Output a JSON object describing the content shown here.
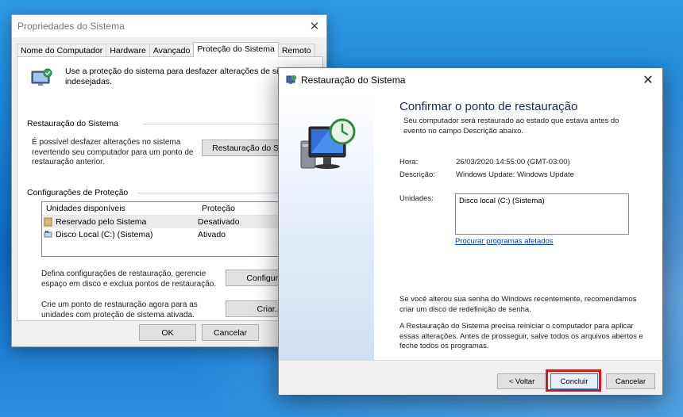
{
  "back_window": {
    "title": "Propriedades do Sistema",
    "tabs": [
      "Nome do Computador",
      "Hardware",
      "Avançado",
      "Proteção do Sistema",
      "Remoto"
    ],
    "active_tab": "Proteção do Sistema",
    "intro_text": "Use a proteção do sistema para desfazer alterações de sistema indesejadas.",
    "restore_section": {
      "title": "Restauração do Sistema",
      "description": "É possível desfazer alterações no sistema revertendo seu computador para um ponto de restauração anterior.",
      "button": "Restauração do Sistema..."
    },
    "protection_section": {
      "title": "Configurações de Proteção",
      "columns": [
        "Unidades disponíveis",
        "Proteção"
      ],
      "rows": [
        {
          "drive": "Reservado pelo Sistema",
          "status": "Desativado",
          "icon": "folder-icon"
        },
        {
          "drive": "Disco Local (C:) (Sistema)",
          "status": "Ativado",
          "icon": "drive-icon"
        }
      ],
      "configure_text": "Defina configurações de restauração, gerencie espaço em disco e exclua pontos de restauração.",
      "configure_button": "Configurar...",
      "create_text": "Crie um ponto de restauração agora para as unidades com proteção de sistema ativada.",
      "create_button": "Criar..."
    },
    "buttons": {
      "ok": "OK",
      "cancel": "Cancelar"
    }
  },
  "dialog": {
    "title": "Restauração do Sistema",
    "heading": "Confirmar o ponto de restauração",
    "subtitle": "Seu computador será restaurado ao estado que estava antes do evento no campo Descrição abaixo.",
    "time_label": "Hora:",
    "time_value": "26/03/2020 14:55:00 (GMT-03:00)",
    "description_label": "Descrição:",
    "description_value": "Windows Update: Windows Update",
    "drives_label": "Unidades:",
    "drives_value": "Disco local (C:) (Sistema)",
    "scan_link": "Procurar programas afetados",
    "password_note": "Se você alterou sua senha do Windows recentemente, recomendamos criar um disco de redefinição de senha.",
    "restart_note": "A Restauração do Sistema precisa reiniciar o computador para aplicar essas alterações. Antes de prosseguir, salve todos os arquivos abertos e feche todos os programas.",
    "buttons": {
      "back": "< Voltar",
      "finish": "Concluir",
      "cancel": "Cancelar"
    },
    "highlight_color": "#d41b1b"
  }
}
